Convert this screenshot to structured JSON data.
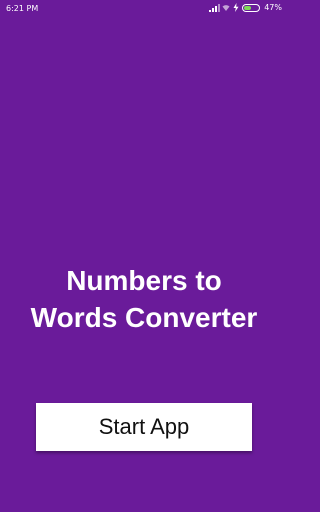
{
  "status_bar": {
    "time": "6:21 PM",
    "battery_percent": "47%",
    "battery_level": 0.47,
    "icons": [
      "signal-icon",
      "wifi-icon",
      "charging-bolt-icon",
      "battery-icon"
    ]
  },
  "main": {
    "title_line1": "Numbers to",
    "title_line2": "Words Converter",
    "start_button_label": "Start App"
  },
  "colors": {
    "background": "#6a1b9a",
    "button_background": "#ffffff",
    "text": "#ffffff",
    "battery_fill": "#7ed957"
  }
}
